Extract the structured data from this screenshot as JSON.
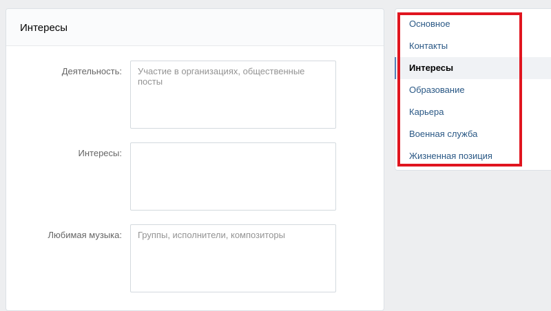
{
  "panel": {
    "title": "Интересы"
  },
  "form": {
    "fields": [
      {
        "label": "Деятельность:",
        "value": "",
        "placeholder": "Участие в организациях, общественные посты"
      },
      {
        "label": "Интересы:",
        "value": "",
        "placeholder": ""
      },
      {
        "label": "Любимая музыка:",
        "value": "",
        "placeholder": "Группы, исполнители, композиторы"
      }
    ]
  },
  "nav": {
    "items": [
      {
        "label": "Основное",
        "active": false
      },
      {
        "label": "Контакты",
        "active": false
      },
      {
        "label": "Интересы",
        "active": true
      },
      {
        "label": "Образование",
        "active": false
      },
      {
        "label": "Карьера",
        "active": false
      },
      {
        "label": "Военная служба",
        "active": false
      },
      {
        "label": "Жизненная позиция",
        "active": false
      }
    ]
  },
  "colors": {
    "link": "#2a5885",
    "active_indicator": "#5181b8",
    "highlight_box": "#e0151f",
    "background": "#edeef0"
  }
}
